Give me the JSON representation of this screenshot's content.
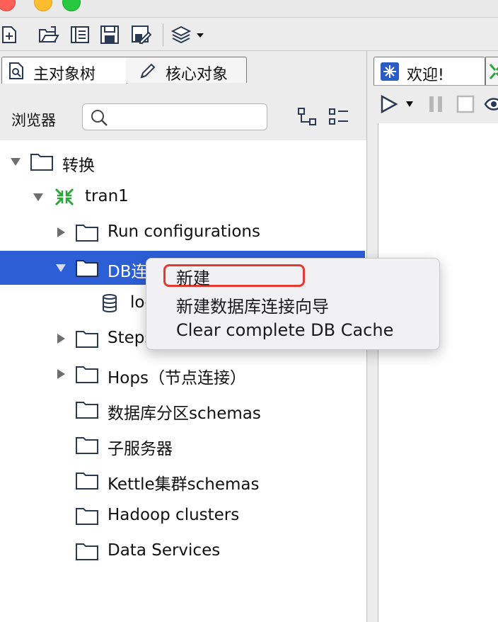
{
  "tabs": {
    "main_tree": "主对象树",
    "core_objects": "核心对象",
    "welcome": "欢迎!"
  },
  "search": {
    "label": "浏览器",
    "placeholder": ""
  },
  "tree": {
    "root": "转换",
    "transformation": "tran1",
    "run_configurations": "Run configurations",
    "db_connections": "DB连接",
    "db_connection_child": "local",
    "steps": "Steps",
    "hops": "Hops（节点连接）",
    "partition_schemas": "数据库分区schemas",
    "slave_servers": "子服务器",
    "kettle_cluster": "Kettle集群schemas",
    "hadoop_clusters": "Hadoop clusters",
    "data_services": "Data Services"
  },
  "context_menu": {
    "items": [
      "新建",
      "新建数据库连接向导",
      "Clear complete DB Cache"
    ]
  },
  "colors": {
    "selection": "#2c5fd6",
    "highlight_box": "#e23a2e",
    "folder_stroke": "#2a3a55",
    "transformation_icon": "#2aa63a"
  }
}
